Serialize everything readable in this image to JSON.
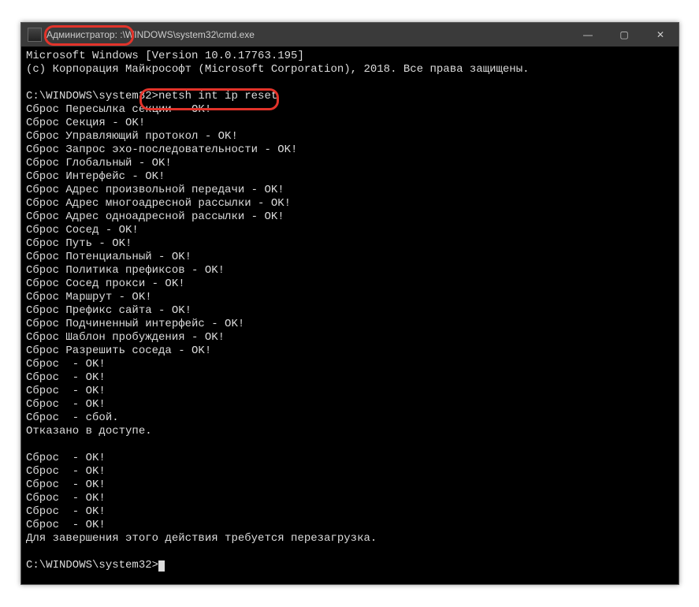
{
  "titlebar": {
    "admin": "Администратор:",
    "path": " :\\WINDOWS\\system32\\cmd.exe"
  },
  "caption": {
    "min": "—",
    "max": "▢",
    "close": "✕"
  },
  "term": {
    "header1": "Microsoft Windows [Version 10.0.17763.195]",
    "header2": "(c) Корпорация Майкрософт (Microsoft Corporation), 2018. Все права защищены.",
    "blank": "",
    "prompt1_path": "C:\\WINDOWS\\system32>",
    "prompt1_cmd": "netsh int ip reset",
    "lines": [
      "Сброс Пересылка секции - OK!",
      "Сброс Секция - OK!",
      "Сброс Управляющий протокол - OK!",
      "Сброс Запрос эхо-последовательности - OK!",
      "Сброс Глобальный - OK!",
      "Сброс Интерфейс - OK!",
      "Сброс Адрес произвольной передачи - OK!",
      "Сброс Адрес многоадресной рассылки - OK!",
      "Сброс Адрес одноадресной рассылки - OK!",
      "Сброс Сосед - OK!",
      "Сброс Путь - OK!",
      "Сброс Потенциальный - OK!",
      "Сброс Политика префиксов - OK!",
      "Сброс Сосед прокси - OK!",
      "Сброс Маршрут - OK!",
      "Сброс Префикс сайта - OK!",
      "Сброс Подчиненный интерфейс - OK!",
      "Сброс Шаблон пробуждения - OK!",
      "Сброс Разрешить соседа - OK!",
      "Сброс  - OK!",
      "Сброс  - OK!",
      "Сброс  - OK!",
      "Сброс  - OK!",
      "Сброс  - сбой.",
      "Отказано в доступе.",
      "",
      "Сброс  - OK!",
      "Сброс  - OK!",
      "Сброс  - OK!",
      "Сброс  - OK!",
      "Сброс  - OK!",
      "Сброс  - OK!",
      "Для завершения этого действия требуется перезагрузка.",
      ""
    ],
    "prompt2": "C:\\WINDOWS\\system32>"
  }
}
